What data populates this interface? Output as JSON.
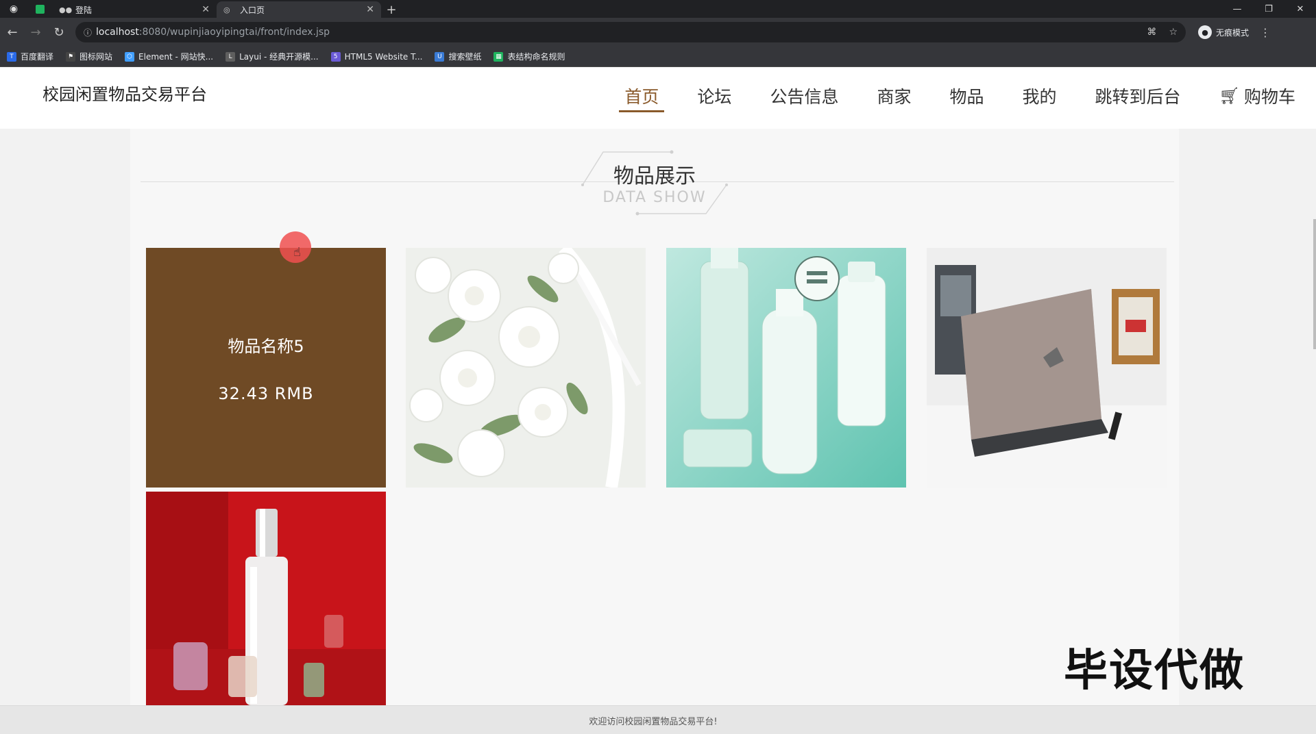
{
  "browser": {
    "tabs": [
      {
        "label": "登陆",
        "icon": "dots-icon"
      },
      {
        "label": "入口页",
        "icon": "globe-icon"
      }
    ],
    "url_host": "localhost",
    "url_rest": ":8080/wupinjiaoyipingtai/front/index.jsp",
    "profile_label": "无痕模式",
    "bookmarks": [
      {
        "label": "百度翻译",
        "color": "#2a6ae8"
      },
      {
        "label": "图标网站",
        "color": "#444444"
      },
      {
        "label": "Element - 网站快...",
        "color": "#409eff"
      },
      {
        "label": "Layui - 经典开源模...",
        "color": "#5f5f5f"
      },
      {
        "label": "HTML5 Website T...",
        "color": "#6b5bd6"
      },
      {
        "label": "搜索壁纸",
        "color": "#3a7bd5"
      },
      {
        "label": "表结构命名规则",
        "color": "#1fb35e"
      }
    ]
  },
  "site": {
    "title": "校园闲置物品交易平台",
    "nav": [
      {
        "label": "首页",
        "active": true
      },
      {
        "label": "论坛"
      },
      {
        "label": "公告信息"
      },
      {
        "label": "商家"
      },
      {
        "label": "物品"
      },
      {
        "label": "我的"
      },
      {
        "label": "跳转到后台"
      },
      {
        "label": "购物车"
      }
    ]
  },
  "section": {
    "title": "物品展示",
    "subtitle": "DATA SHOW"
  },
  "products": {
    "hovered": {
      "name": "物品名称5",
      "price": "32.43 RMB"
    }
  },
  "watermark": "毕设代做",
  "footer": {
    "text": "欢迎访问校园闲置物品交易平台!"
  },
  "colors": {
    "accent": "#8a5a2b",
    "card_hover": "#6f4a25"
  }
}
